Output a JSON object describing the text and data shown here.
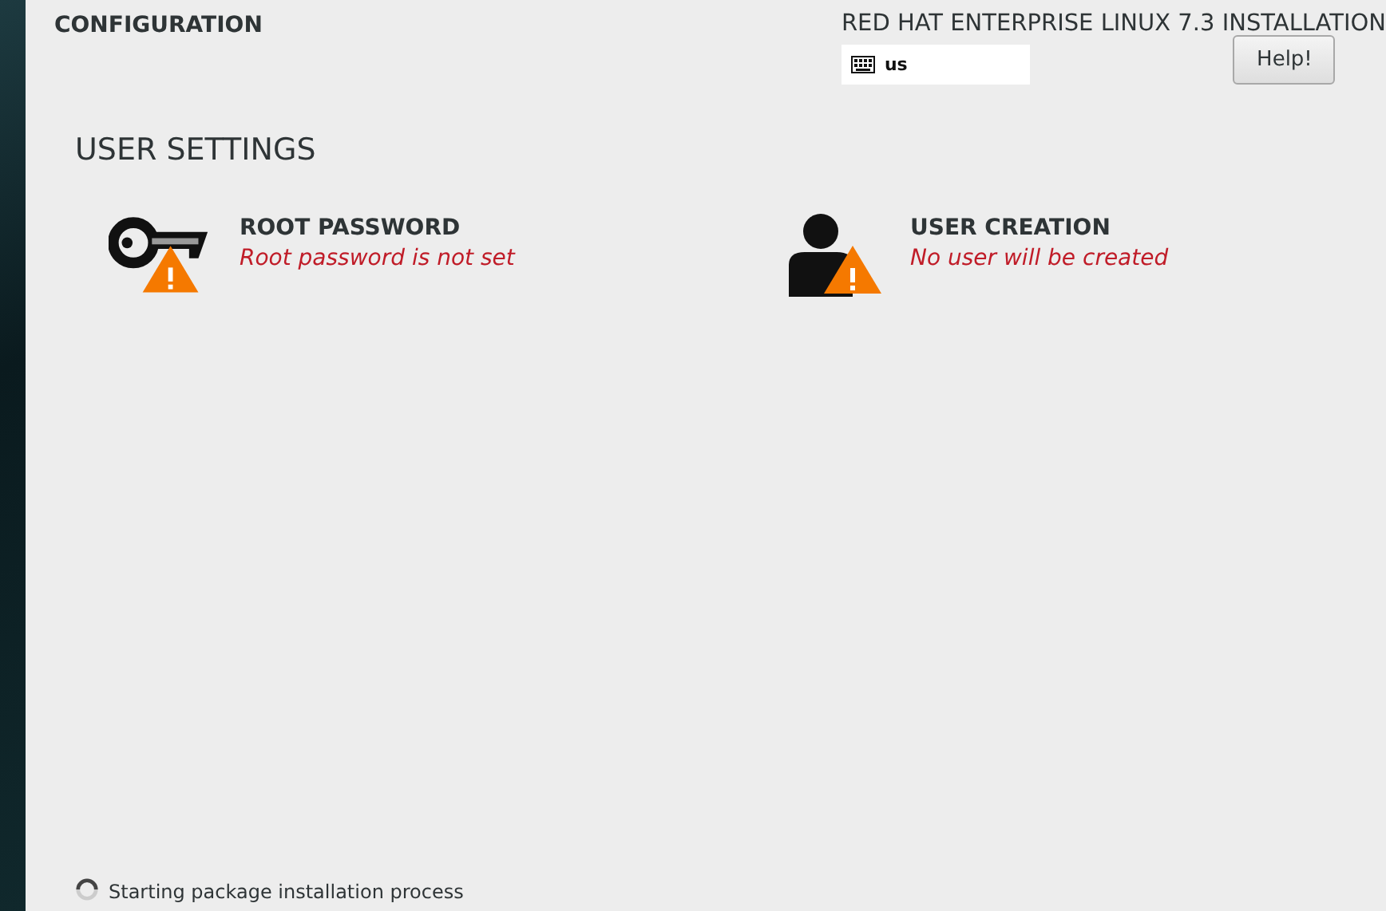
{
  "header": {
    "section_title": "CONFIGURATION",
    "product_title": "RED HAT ENTERPRISE LINUX 7.3 INSTALLATION",
    "keyboard_layout": "us",
    "help_button": "Help!"
  },
  "category": {
    "title": "USER SETTINGS",
    "spokes": [
      {
        "kind": "key",
        "title": "ROOT PASSWORD",
        "status": "Root password is not set",
        "warning": true
      },
      {
        "kind": "user",
        "title": "USER CREATION",
        "status": "No user will be created",
        "warning": true
      }
    ]
  },
  "status_bar": {
    "message": "Starting package installation process",
    "busy": true
  }
}
